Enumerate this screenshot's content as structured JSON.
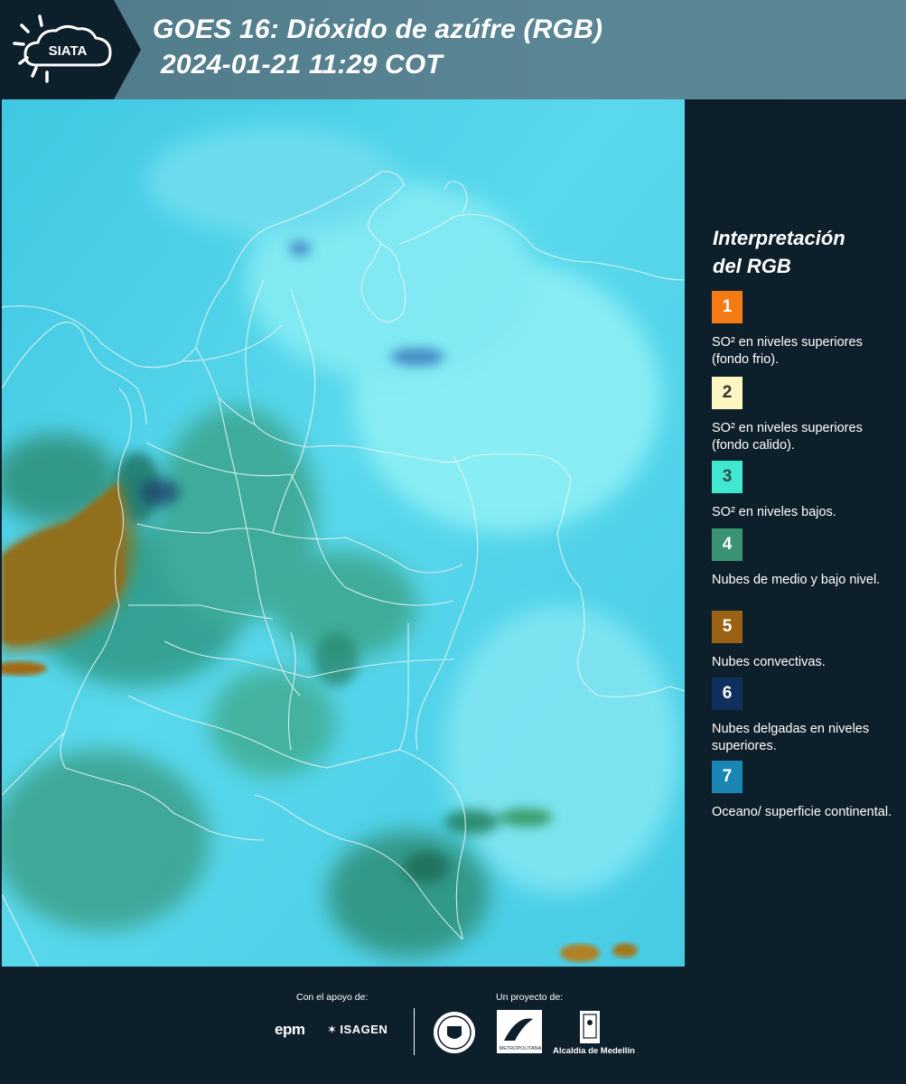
{
  "header": {
    "title_line_1": "GOES 16: Dióxido de azúfre (RGB)",
    "title_line_2": "2024-01-21 11:29 COT",
    "logo_text": "SIATA"
  },
  "legend": {
    "title_line_1": "Interpretación",
    "title_line_2": "del RGB",
    "items": [
      {
        "number": "1",
        "label": "SO² en niveles superiores (fondo frio).",
        "color": "#f47a14",
        "text_color": "#ffffff"
      },
      {
        "number": "2",
        "label": "SO² en niveles superiores (fondo calido).",
        "color": "#fdf6c0",
        "text_color": "#333333"
      },
      {
        "number": "3",
        "label": "SO² en niveles bajos.",
        "color": "#3fe8cf",
        "text_color": "#2a4a4a"
      },
      {
        "number": "4",
        "label": "Nubes de medio y bajo nivel.",
        "color": "#3a9473",
        "text_color": "#ffffff"
      },
      {
        "number": "5",
        "label": "Nubes convectivas.",
        "color": "#9a6212",
        "text_color": "#ffffff"
      },
      {
        "number": "6",
        "label": "Nubes delgadas en niveles superiores.",
        "color": "#0f2f5e",
        "text_color": "#ffffff"
      },
      {
        "number": "7",
        "label": "Oceano/ superficie continental.",
        "color": "#1a86b4",
        "text_color": "#ffffff"
      }
    ]
  },
  "footer": {
    "support_caption": "Con el apoyo de:",
    "project_caption": "Un proyecto de:",
    "sponsor_1": "epm",
    "sponsor_2": "ISAGEN",
    "partner_metro": "Área METROPOLITANA Valle de Aburrá",
    "partner_alcaldia": "Alcaldía de Medellín"
  },
  "colors": {
    "header_bg": "#5a8594",
    "page_bg": "#0e1f2c",
    "map_background": "#3fcde6"
  }
}
